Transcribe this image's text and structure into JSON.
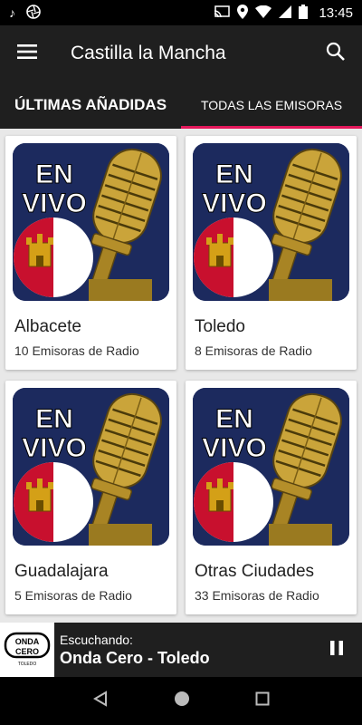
{
  "status_bar": {
    "time": "13:45"
  },
  "app_bar": {
    "title": "Castilla la Mancha"
  },
  "tabs": [
    {
      "label": "ÚLTIMAS AÑADIDAS",
      "active": false
    },
    {
      "label": "TODAS LAS EMISORAS",
      "active": true
    }
  ],
  "thumbnail": {
    "overlay_text_line1": "EN",
    "overlay_text_line2": "VIVO"
  },
  "cards": [
    {
      "name": "Albacete",
      "count": "10 Emisoras de Radio"
    },
    {
      "name": "Toledo",
      "count": "8 Emisoras de Radio"
    },
    {
      "name": "Guadalajara",
      "count": "5 Emisoras de Radio"
    },
    {
      "name": "Otras Ciudades",
      "count": "33 Emisoras de Radio"
    }
  ],
  "player": {
    "label": "Escuchando:",
    "station": "Onda Cero - Toledo",
    "logo_line1": "ONDA",
    "logo_line2": "CERO",
    "logo_sub": "TOLEDO"
  },
  "colors": {
    "accent": "#e4185b",
    "bar": "#1f1f1f",
    "thumb_bg": "#1c2a5e",
    "flag_red": "#c8102e"
  }
}
